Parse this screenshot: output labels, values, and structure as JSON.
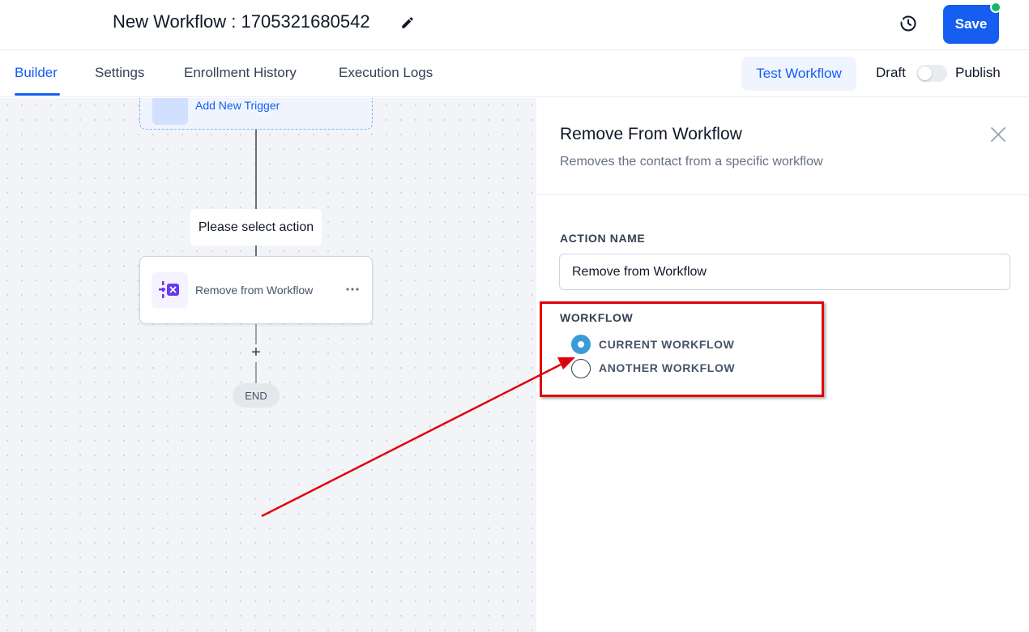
{
  "header": {
    "title": "New Workflow : 1705321680542",
    "save_label": "Save"
  },
  "tabs": [
    {
      "label": "Builder",
      "active": true
    },
    {
      "label": "Settings",
      "active": false
    },
    {
      "label": "Enrollment History",
      "active": false
    },
    {
      "label": "Execution Logs",
      "active": false
    }
  ],
  "toolbar": {
    "test_label": "Test Workflow",
    "draft_label": "Draft",
    "publish_label": "Publish",
    "published": false
  },
  "canvas": {
    "trigger_label": "Add New Trigger",
    "select_action_label": "Please select action",
    "action_card_label": "Remove from Workflow",
    "end_label": "END"
  },
  "panel": {
    "title": "Remove From Workflow",
    "subtitle": "Removes the contact from a specific workflow",
    "action_name_label": "ACTION NAME",
    "action_name_value": "Remove from Workflow",
    "workflow_label": "WORKFLOW",
    "options": [
      {
        "label": "CURRENT WORKFLOW",
        "checked": true
      },
      {
        "label": "ANOTHER WORKFLOW",
        "checked": false
      }
    ]
  },
  "colors": {
    "primary": "#155eef",
    "online_status": "#12b76a",
    "radio_checked": "#3b9bd9",
    "annotation": "#e0000b"
  }
}
